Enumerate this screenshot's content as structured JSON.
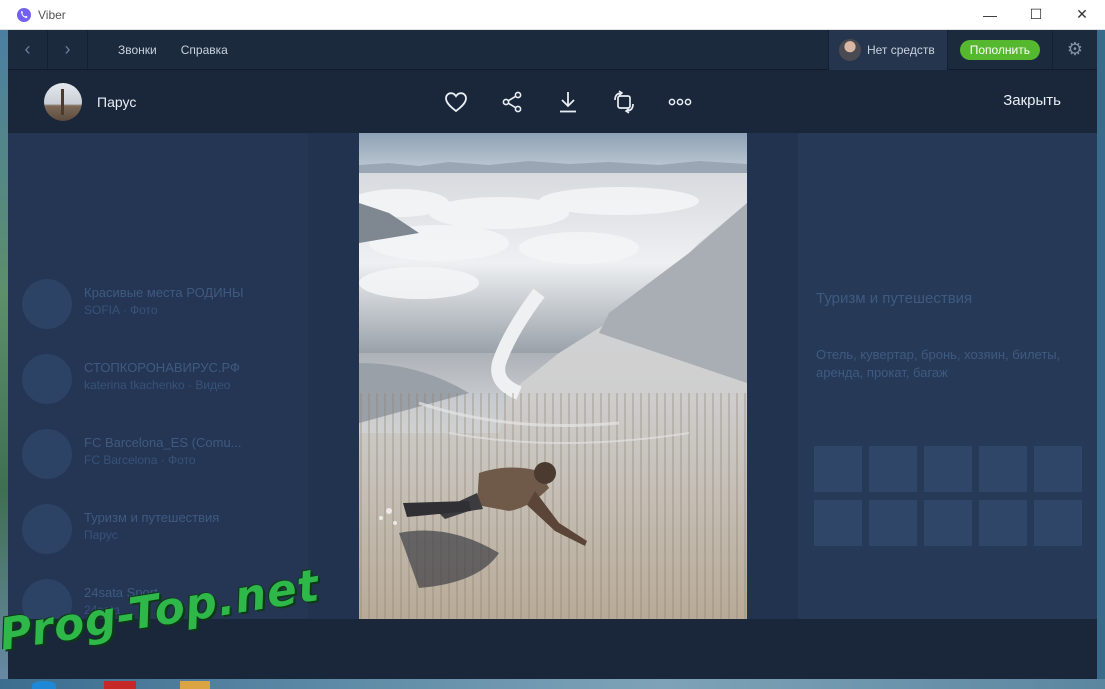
{
  "window": {
    "title": "Viber",
    "minimize_glyph": "—",
    "maximize_glyph": "☐",
    "close_glyph": "✕"
  },
  "topbar": {
    "back_glyph": "‹",
    "forward_glyph": "›",
    "menu": [
      {
        "label": "Звонки"
      },
      {
        "label": "Справка"
      }
    ],
    "balance_label": "Нет средств",
    "topup_label": "Пополнить",
    "settings_glyph": "⚙"
  },
  "viewer": {
    "channel_name": "Парус",
    "actions": [
      {
        "name": "like-icon"
      },
      {
        "name": "share-icon"
      },
      {
        "name": "download-icon"
      },
      {
        "name": "rotate-icon"
      },
      {
        "name": "more-icon"
      }
    ],
    "close_label": "Закрыть"
  },
  "background": {
    "chats": [
      {
        "title": "Красивые места РОДИНЫ",
        "subtitle": "SOFIA · Фото"
      },
      {
        "title": "СТОПКОРОНАВИРУС.РФ",
        "subtitle": "katerina tkachenko · Видео"
      },
      {
        "title": "FC Barcelona_ES (Comu...",
        "subtitle": "FC Barcelona · Фото"
      },
      {
        "title": "Туризм и путешествия",
        "subtitle": "Парус"
      },
      {
        "title": "24sata Sport",
        "subtitle": "24sata"
      }
    ],
    "right_title": "Туризм и путешествия",
    "right_tags": "Отель, кувертар, бронь, хозяин, билеты, аренда, прокат, багаж"
  },
  "watermark": "Prog-Top.net",
  "colors": {
    "app_bg": "#1f2e45",
    "topbar_bg": "#1c2a3e",
    "accent_green": "#56b82f",
    "viber_purple": "#7360f2"
  }
}
